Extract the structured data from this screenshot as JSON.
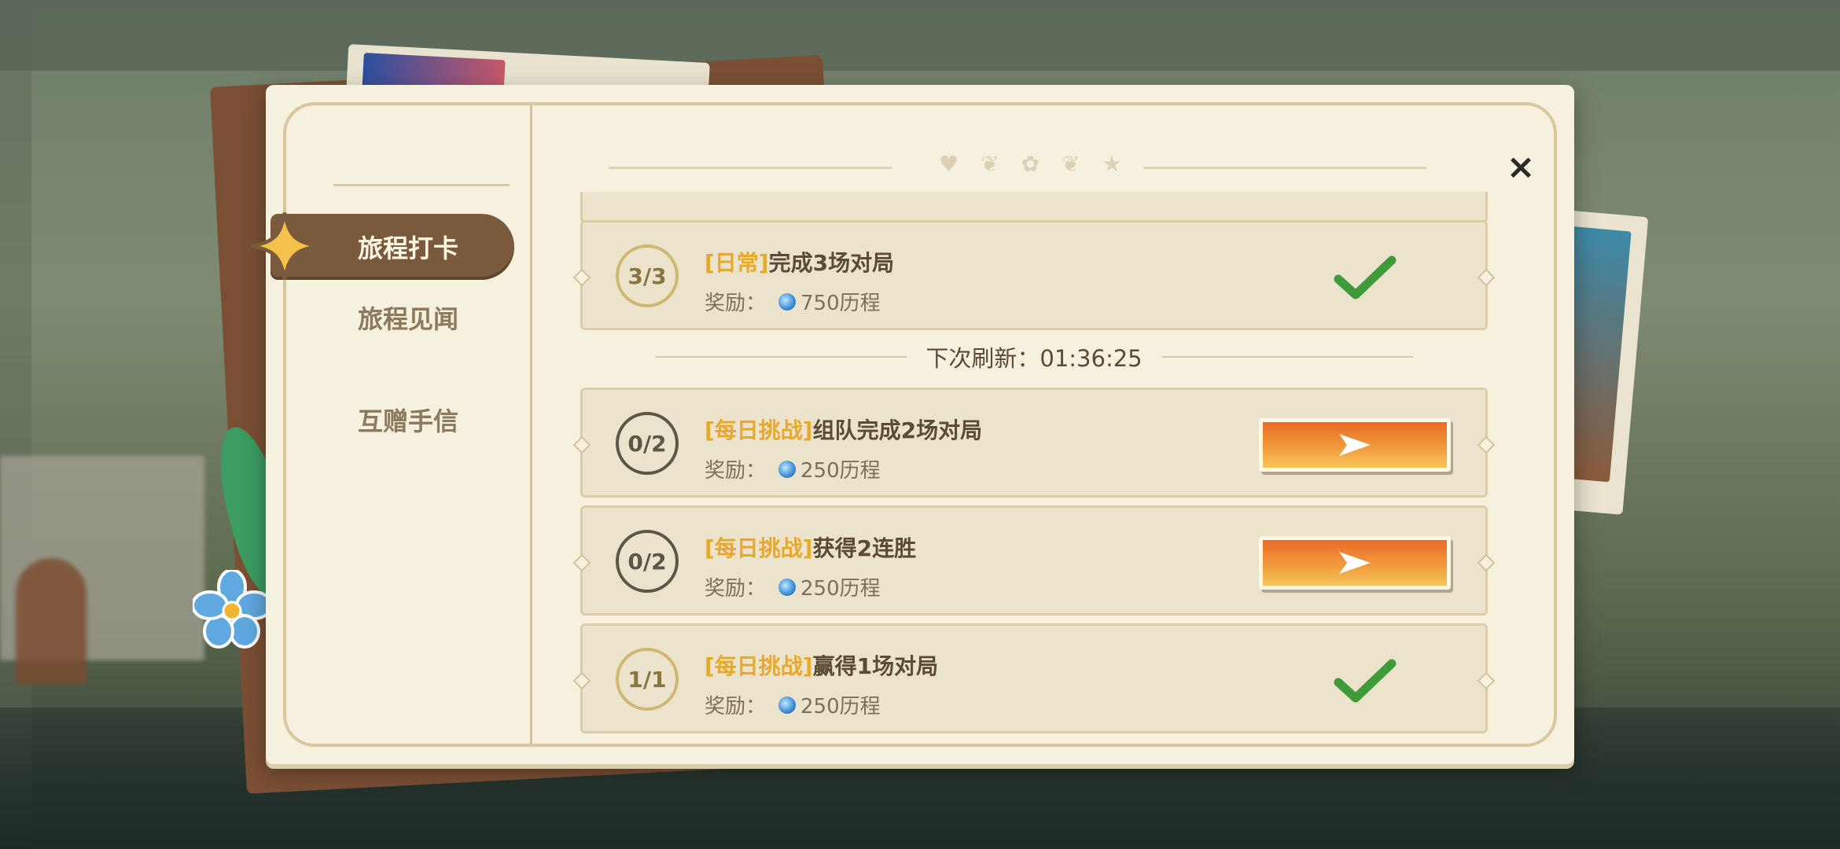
{
  "background": {
    "back_label": ""
  },
  "sidebar": {
    "items": [
      {
        "label": "旅程打卡",
        "active": true
      },
      {
        "label": "旅程见闻",
        "active": false
      },
      {
        "label": "互赠手信",
        "active": false
      }
    ]
  },
  "header": {
    "ornament_icons": [
      "heart-icon",
      "sprout-icon",
      "paw-icon",
      "sprout-icon",
      "star-icon"
    ],
    "close_label": "×"
  },
  "refresh": {
    "label": "下次刷新：01:36:25"
  },
  "tasks": [
    {
      "progress": "3/3",
      "tag": "[日常]",
      "title": "完成3场对局",
      "reward_label": "奖励：",
      "reward_value": "750历程",
      "status": "done"
    },
    {
      "progress": "0/2",
      "tag": "[每日挑战]",
      "title": "组队完成2场对局",
      "reward_label": "奖励：",
      "reward_value": "250历程",
      "status": "go"
    },
    {
      "progress": "0/2",
      "tag": "[每日挑战]",
      "title": "获得2连胜",
      "reward_label": "奖励：",
      "reward_value": "250历程",
      "status": "go"
    },
    {
      "progress": "1/1",
      "tag": "[每日挑战]",
      "title": "赢得1场对局",
      "reward_label": "奖励：",
      "reward_value": "250历程",
      "status": "done"
    }
  ],
  "colors": {
    "accent_tag": "#e8a92a",
    "go_button": "#ea6a28",
    "check": "#3f9a3a",
    "active_menu": "#7a5a3c"
  }
}
